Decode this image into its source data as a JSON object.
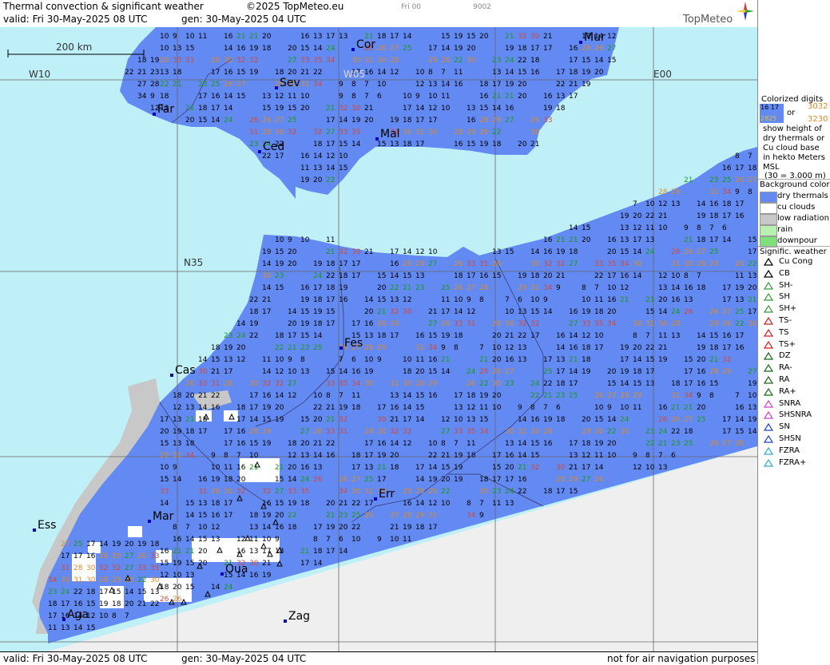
{
  "header": {
    "title": "Thermal convection & significant weather",
    "copyright": "©2025 TopMeteo.eu",
    "fri00": "Fri 00",
    "code": "9002",
    "valid": "valid:  Fri  30-May-2025  08 UTC",
    "gen": "gen: 30-May-2025 04 UTC",
    "brand": "TopMeteo"
  },
  "scale": {
    "label": "200 km"
  },
  "grid": {
    "w10": "W10",
    "w05": "W05",
    "e00": "E00",
    "n35": "N35"
  },
  "cities": [
    {
      "name": "Cor"
    },
    {
      "name": "Mur"
    },
    {
      "name": "Sev"
    },
    {
      "name": "Far"
    },
    {
      "name": "Ced"
    },
    {
      "name": "Mal"
    },
    {
      "name": "Fes"
    },
    {
      "name": "Cas"
    },
    {
      "name": "Err"
    },
    {
      "name": "Ess"
    },
    {
      "name": "Mar"
    },
    {
      "name": "Oua"
    },
    {
      "name": "Aga"
    },
    {
      "name": "Zag"
    }
  ],
  "footer": {
    "valid": "valid:  Fri  30-May-2025  08 UTC",
    "gen": "gen: 30-May-2025 04 UTC",
    "disclaimer": "not for air navigation purposes"
  },
  "legend": {
    "colorized": "Colorized digits",
    "sample1": "16 17",
    "or": "or",
    "sample2": "3032",
    "sample3": "2825",
    "sample4": "3230",
    "desc1": "show height of",
    "desc2": "dry thermals or",
    "desc3": "Cu cloud base",
    "desc4": "in hekto Meters",
    "desc5": "MSL",
    "desc6": "(30 = 3.000 m)",
    "bg_title": "Background color",
    "bg_items": [
      {
        "label": "dry thermals",
        "color": "#6389f2"
      },
      {
        "label": "cu clouds",
        "color": "#ffffff"
      },
      {
        "label": "low radiation",
        "color": "#c8c8c8"
      },
      {
        "label": "rain",
        "color": "#b8f0b0"
      },
      {
        "label": "downpour",
        "color": "#7ee07a"
      }
    ],
    "sig_title": "Signific. weather",
    "sig_items": [
      {
        "label": "Cu Cong",
        "icon": "cu-cong-icon",
        "color": "#000000"
      },
      {
        "label": "CB",
        "icon": "cb-icon",
        "color": "#000000"
      },
      {
        "label": "SH-",
        "icon": "shower-light-icon",
        "color": "#3a9a3a"
      },
      {
        "label": "SH",
        "icon": "shower-icon",
        "color": "#3a9a3a"
      },
      {
        "label": "SH+",
        "icon": "shower-heavy-icon",
        "color": "#3a9a3a"
      },
      {
        "label": "TS-",
        "icon": "thunder-light-icon",
        "color": "#cc2222"
      },
      {
        "label": "TS",
        "icon": "thunder-icon",
        "color": "#cc2222"
      },
      {
        "label": "TS+",
        "icon": "thunder-heavy-icon",
        "color": "#cc2222"
      },
      {
        "label": "DZ",
        "icon": "drizzle-icon",
        "color": "#1a6a1a"
      },
      {
        "label": "RA-",
        "icon": "rain-light-icon",
        "color": "#1a6a1a"
      },
      {
        "label": "RA",
        "icon": "rain-icon",
        "color": "#1a6a1a"
      },
      {
        "label": "RA+",
        "icon": "rain-heavy-icon",
        "color": "#1a6a1a"
      },
      {
        "label": "SNRA",
        "icon": "snow-rain-icon",
        "color": "#cc44cc"
      },
      {
        "label": "SHSNRA",
        "icon": "shower-snow-rain-icon",
        "color": "#cc44cc"
      },
      {
        "label": "SN",
        "icon": "snow-icon",
        "color": "#2244cc"
      },
      {
        "label": "SHSN",
        "icon": "shower-snow-icon",
        "color": "#2244cc"
      },
      {
        "label": "FZRA",
        "icon": "freezing-rain-icon",
        "color": "#33aacc"
      },
      {
        "label": "FZRA+",
        "icon": "freezing-rain-heavy-icon",
        "color": "#33aacc"
      }
    ]
  },
  "thermal_values": [
    {
      "v": "10",
      "c": "k"
    },
    {
      "v": "9",
      "c": "k"
    },
    {
      "v": "10",
      "c": "k"
    },
    {
      "v": "11",
      "c": "k"
    },
    {
      "v": "16",
      "c": "k"
    },
    {
      "v": "21",
      "c": "g"
    },
    {
      "v": "21",
      "c": "g"
    },
    {
      "v": "20",
      "c": "k"
    },
    {
      "v": "16",
      "c": "k"
    },
    {
      "v": "13",
      "c": "k"
    },
    {
      "v": "17",
      "c": "k"
    },
    {
      "v": "13",
      "c": "k"
    },
    {
      "v": "21",
      "c": "g"
    },
    {
      "v": "18",
      "c": "k"
    },
    {
      "v": "17",
      "c": "k"
    },
    {
      "v": "14",
      "c": "k"
    },
    {
      "v": "15",
      "c": "k"
    },
    {
      "v": "19",
      "c": "k"
    },
    {
      "v": "15",
      "c": "k"
    },
    {
      "v": "20",
      "c": "k"
    },
    {
      "v": "21",
      "c": "g"
    },
    {
      "v": "32",
      "c": "r"
    },
    {
      "v": "30",
      "c": "r"
    },
    {
      "v": "21",
      "c": "k"
    },
    {
      "v": "17",
      "c": "k"
    },
    {
      "v": "14",
      "c": "k"
    },
    {
      "v": "12",
      "c": "k"
    },
    {
      "v": "10",
      "c": "k"
    },
    {
      "v": "13",
      "c": "k"
    },
    {
      "v": "15",
      "c": "k"
    },
    {
      "v": "14",
      "c": "k"
    },
    {
      "v": "16",
      "c": "k"
    },
    {
      "v": "19",
      "c": "k"
    },
    {
      "v": "18",
      "c": "k"
    },
    {
      "v": "20",
      "c": "k"
    },
    {
      "v": "15",
      "c": "k"
    },
    {
      "v": "14",
      "c": "k"
    },
    {
      "v": "24",
      "c": "g"
    },
    {
      "v": "26",
      "c": "r"
    },
    {
      "v": "26",
      "c": "o"
    },
    {
      "v": "27",
      "c": "o"
    },
    {
      "v": "25",
      "c": "g"
    },
    {
      "v": "17",
      "c": "k"
    },
    {
      "v": "14",
      "c": "k"
    },
    {
      "v": "19",
      "c": "k"
    },
    {
      "v": "20",
      "c": "k"
    },
    {
      "v": "19",
      "c": "k"
    },
    {
      "v": "18",
      "c": "k"
    },
    {
      "v": "17",
      "c": "k"
    },
    {
      "v": "17",
      "c": "k"
    },
    {
      "v": "16",
      "c": "k"
    },
    {
      "v": "28",
      "c": "o"
    },
    {
      "v": "29",
      "c": "o"
    },
    {
      "v": "27",
      "c": "g"
    },
    {
      "v": "26",
      "c": "o"
    },
    {
      "v": "33",
      "c": "r"
    },
    {
      "v": "31",
      "c": "r"
    },
    {
      "v": "28",
      "c": "o"
    },
    {
      "v": "30",
      "c": "o"
    },
    {
      "v": "32",
      "c": "r"
    },
    {
      "v": "32",
      "c": "r"
    },
    {
      "v": "27",
      "c": "g"
    },
    {
      "v": "33",
      "c": "r"
    },
    {
      "v": "35",
      "c": "r"
    },
    {
      "v": "34",
      "c": "r"
    },
    {
      "v": "30",
      "c": "o"
    },
    {
      "v": "31",
      "c": "o"
    },
    {
      "v": "30",
      "c": "o"
    },
    {
      "v": "28",
      "c": "o"
    },
    {
      "v": "29",
      "c": "o"
    },
    {
      "v": "26",
      "c": "o"
    },
    {
      "v": "22",
      "c": "g"
    },
    {
      "v": "30",
      "c": "o"
    },
    {
      "v": "23",
      "c": "g"
    },
    {
      "v": "24",
      "c": "g"
    },
    {
      "v": "22",
      "c": "k"
    },
    {
      "v": "18",
      "c": "k"
    },
    {
      "v": "17",
      "c": "k"
    },
    {
      "v": "15",
      "c": "k"
    },
    {
      "v": "14",
      "c": "k"
    },
    {
      "v": "15",
      "c": "k"
    },
    {
      "v": "13",
      "c": "k"
    },
    {
      "v": "18",
      "c": "k"
    },
    {
      "v": "17",
      "c": "k"
    },
    {
      "v": "16",
      "c": "k"
    },
    {
      "v": "15",
      "c": "k"
    },
    {
      "v": "19",
      "c": "k"
    },
    {
      "v": "18",
      "c": "k"
    },
    {
      "v": "20",
      "c": "k"
    },
    {
      "v": "21",
      "c": "k"
    },
    {
      "v": "22",
      "c": "k"
    },
    {
      "v": "17",
      "c": "k"
    },
    {
      "v": "16",
      "c": "k"
    },
    {
      "v": "14",
      "c": "k"
    },
    {
      "v": "12",
      "c": "k"
    },
    {
      "v": "10",
      "c": "k"
    },
    {
      "v": "8",
      "c": "k"
    },
    {
      "v": "7",
      "c": "k"
    },
    {
      "v": "11",
      "c": "k"
    },
    {
      "v": "13",
      "c": "k"
    },
    {
      "v": "14",
      "c": "k"
    },
    {
      "v": "15",
      "c": "k"
    },
    {
      "v": "16",
      "c": "k"
    },
    {
      "v": "17",
      "c": "k"
    },
    {
      "v": "18",
      "c": "k"
    },
    {
      "v": "19",
      "c": "k"
    },
    {
      "v": "20",
      "c": "k"
    },
    {
      "v": "22",
      "c": "g"
    },
    {
      "v": "21",
      "c": "g"
    },
    {
      "v": "23",
      "c": "g"
    },
    {
      "v": "25",
      "c": "g"
    },
    {
      "v": "26",
      "c": "o"
    },
    {
      "v": "27",
      "c": "o"
    },
    {
      "v": "28",
      "c": "o"
    },
    {
      "v": "29",
      "c": "o"
    },
    {
      "v": "31",
      "c": "o"
    },
    {
      "v": "34",
      "c": "r"
    },
    {
      "v": "9",
      "c": "k"
    },
    {
      "v": "8",
      "c": "k"
    },
    {
      "v": "7",
      "c": "k"
    },
    {
      "v": "10",
      "c": "k"
    },
    {
      "v": "12",
      "c": "k"
    },
    {
      "v": "13",
      "c": "k"
    },
    {
      "v": "14",
      "c": "k"
    },
    {
      "v": "16",
      "c": "k"
    },
    {
      "v": "18",
      "c": "k"
    },
    {
      "v": "17",
      "c": "k"
    },
    {
      "v": "19",
      "c": "k"
    },
    {
      "v": "20",
      "c": "k"
    },
    {
      "v": "22",
      "c": "k"
    },
    {
      "v": "21",
      "c": "k"
    },
    {
      "v": "19",
      "c": "k"
    },
    {
      "v": "18",
      "c": "k"
    },
    {
      "v": "17",
      "c": "k"
    },
    {
      "v": "16",
      "c": "k"
    },
    {
      "v": "14",
      "c": "k"
    },
    {
      "v": "15",
      "c": "k"
    },
    {
      "v": "13",
      "c": "k"
    },
    {
      "v": "12",
      "c": "k"
    },
    {
      "v": "11",
      "c": "k"
    },
    {
      "v": "10",
      "c": "k"
    },
    {
      "v": "9",
      "c": "k"
    },
    {
      "v": "8",
      "c": "k"
    },
    {
      "v": "7",
      "c": "k"
    },
    {
      "v": "6",
      "c": "k"
    }
  ],
  "colors": {
    "sea": "#bff0f7",
    "dry": "#6389f2",
    "low_radiation": "#c8c8c8",
    "outside": "#efefef",
    "cu": "#ffffff",
    "border": "#3a3a6a",
    "num_green": "#1b9a1b",
    "num_orange": "#d98a2b",
    "num_red": "#d24a3a"
  }
}
